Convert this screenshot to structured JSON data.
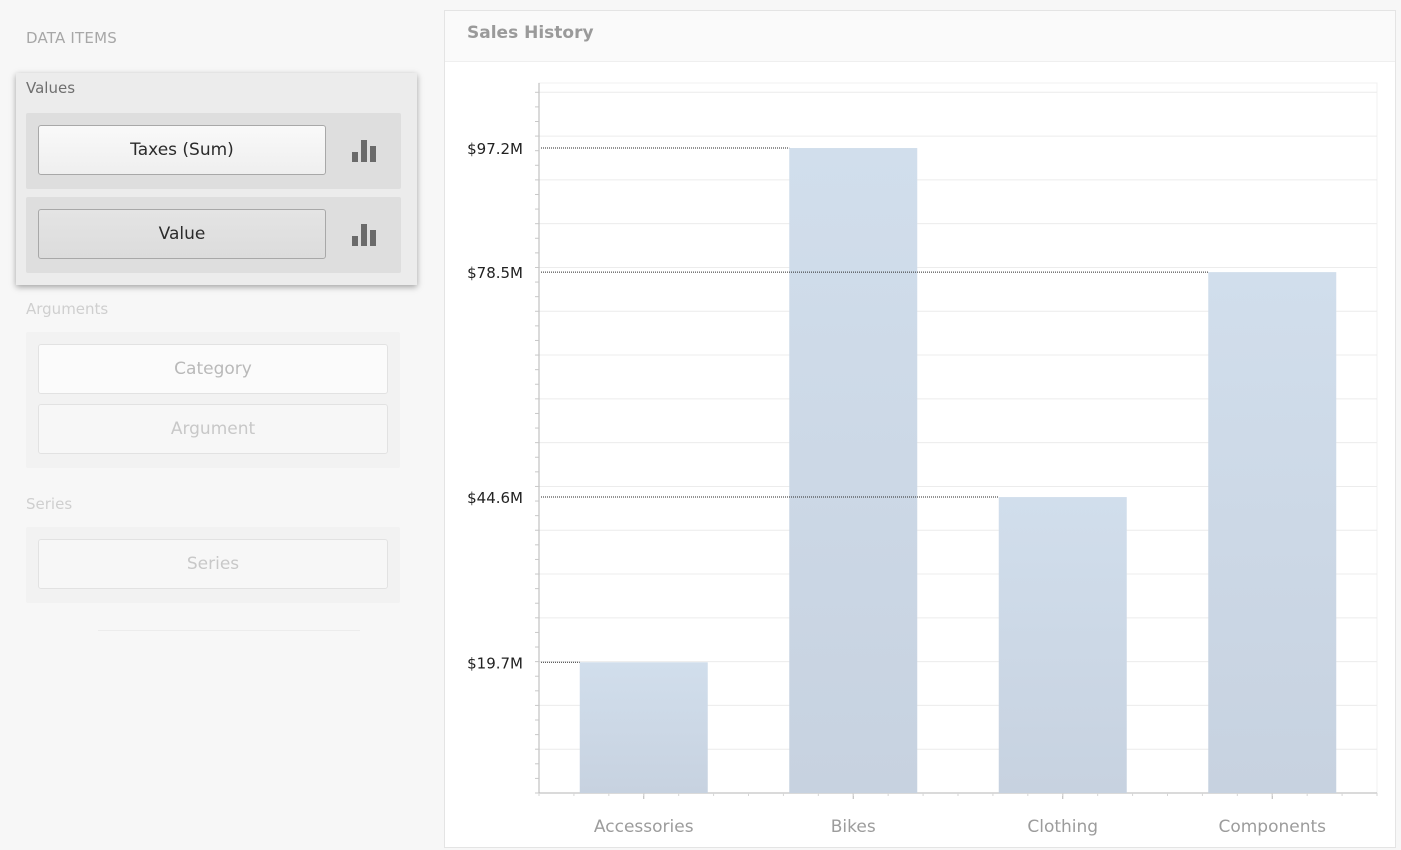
{
  "panel": {
    "heading": "DATA ITEMS",
    "values_label": "Values",
    "values": [
      {
        "label": "Taxes (Sum)",
        "icon": "bar-chart-icon"
      },
      {
        "label": "Value",
        "icon": "bar-chart-icon"
      }
    ],
    "arguments_label": "Arguments",
    "arguments": [
      "Category",
      "Argument"
    ],
    "series_label": "Series",
    "series": [
      "Series"
    ]
  },
  "chart": {
    "title": "Sales History"
  },
  "chart_data": {
    "type": "bar",
    "title": "Sales History",
    "categories": [
      "Accessories",
      "Bikes",
      "Clothing",
      "Components"
    ],
    "values": [
      19.7,
      97.2,
      44.6,
      78.5
    ],
    "value_labels": [
      "$19.7M",
      "$97.2M",
      "$44.6M",
      "$78.5M"
    ],
    "unit": "$M",
    "ylim": [
      0,
      107
    ],
    "grid": true,
    "xlabel": "",
    "ylabel": "",
    "colors": {
      "bar_top": "#d1deec",
      "bar_bottom": "#c7d2e0",
      "grid": "#ececec",
      "axis": "#b5b5b5"
    }
  }
}
